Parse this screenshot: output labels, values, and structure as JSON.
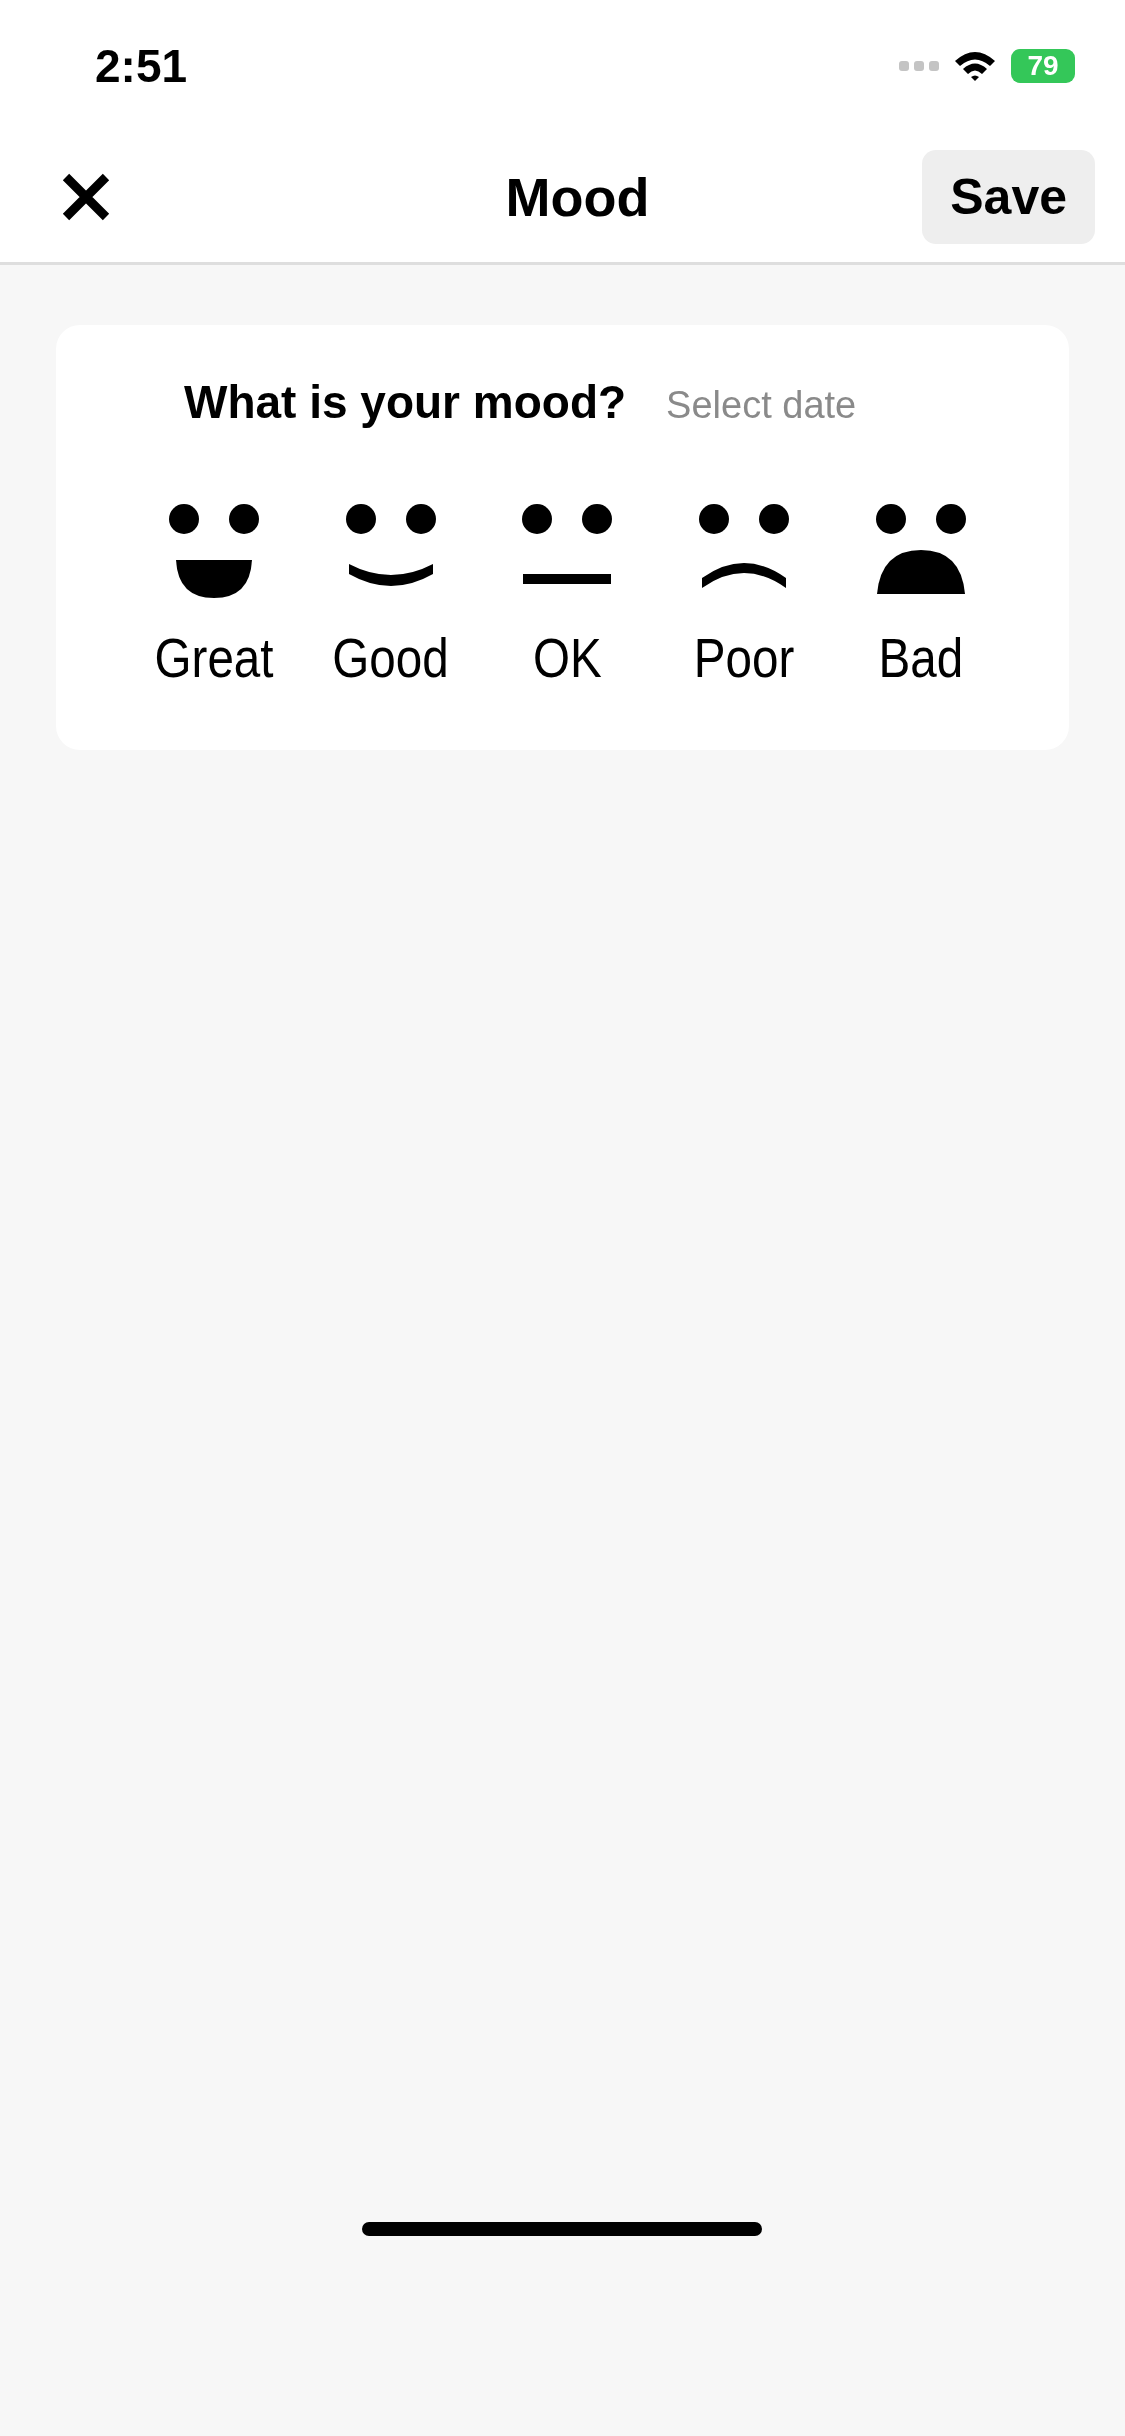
{
  "status_bar": {
    "time": "2:51",
    "battery": "79"
  },
  "nav": {
    "title": "Mood",
    "save": "Save"
  },
  "card": {
    "question": "What is your mood?",
    "date_link": "Select date",
    "moods": [
      {
        "kind": "great",
        "label": "Great"
      },
      {
        "kind": "good",
        "label": "Good"
      },
      {
        "kind": "ok",
        "label": "OK"
      },
      {
        "kind": "poor",
        "label": "Poor"
      },
      {
        "kind": "bad",
        "label": "Bad"
      }
    ]
  }
}
